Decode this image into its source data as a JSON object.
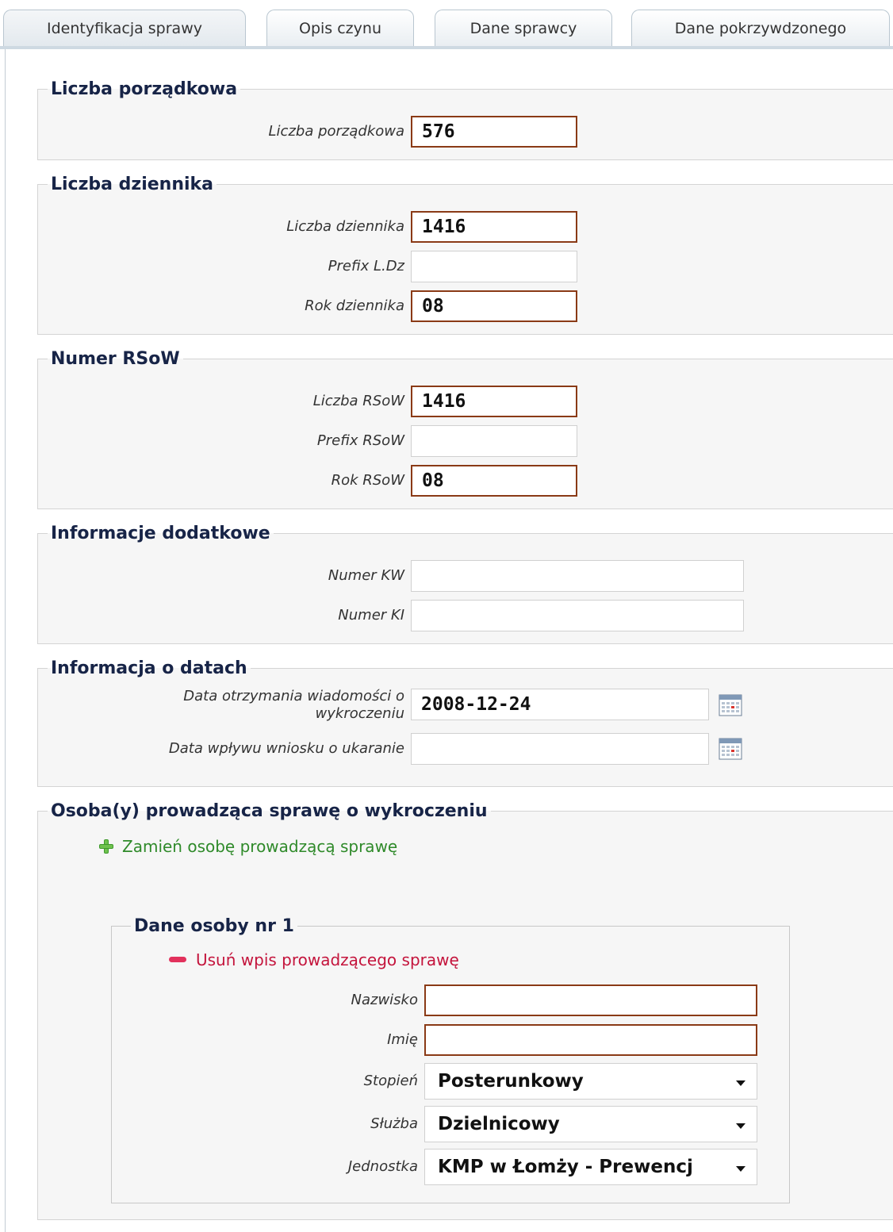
{
  "tabs": [
    {
      "label": "Identyfikacja sprawy",
      "active": true
    },
    {
      "label": "Opis czynu",
      "active": false
    },
    {
      "label": "Dane sprawcy",
      "active": false
    },
    {
      "label": "Dane pokrzywdzonego",
      "active": false
    }
  ],
  "liczba_porzadkowa": {
    "legend": "Liczba porządkowa",
    "field_label": "Liczba porządkowa",
    "value": "576"
  },
  "liczba_dziennika": {
    "legend": "Liczba dziennika",
    "liczba_label": "Liczba dziennika",
    "liczba_value": "1416",
    "prefix_label": "Prefix L.Dz",
    "prefix_value": "",
    "rok_label": "Rok dziennika",
    "rok_value": "08"
  },
  "numer_rsow": {
    "legend": "Numer RSoW",
    "liczba_label": "Liczba RSoW",
    "liczba_value": "1416",
    "prefix_label": "Prefix RSoW",
    "prefix_value": "",
    "rok_label": "Rok RSoW",
    "rok_value": "08"
  },
  "informacje_dodatkowe": {
    "legend": "Informacje dodatkowe",
    "kw_label": "Numer KW",
    "kw_value": "",
    "ki_label": "Numer KI",
    "ki_value": ""
  },
  "informacja_o_datach": {
    "legend": "Informacja o datach",
    "data_otrzymania_label_line1": "Data otrzymania wiadomości o",
    "data_otrzymania_label_line2": "wykroczeniu",
    "data_otrzymania_value": "2008-12-24",
    "data_wplywu_label": "Data wpływu wniosku o ukaranie",
    "data_wplywu_value": ""
  },
  "osoby_prowadzace": {
    "legend": "Osoba(y) prowadząca sprawę o wykroczeniu",
    "zamien_link": "Zamień osobę prowadzącą sprawę",
    "osoba": {
      "legend": "Dane osoby nr 1",
      "usun_link": "Usuń wpis prowadzącego sprawę",
      "nazwisko_label": "Nazwisko",
      "nazwisko_value": "",
      "imie_label": "Imię",
      "imie_value": "",
      "stopien_label": "Stopień",
      "stopien_value": "Posterunkowy",
      "sluzba_label": "Służba",
      "sluzba_value": "Dzielnicowy",
      "jednostka_label": "Jednostka",
      "jednostka_value": "KMP w Łomży - Prewencj"
    }
  },
  "icons": {
    "calendar": "calendar-icon",
    "add": "plus-icon",
    "remove": "minus-icon",
    "dropdown": "chevron-down-icon"
  },
  "colors": {
    "required_border": "#8a3a16",
    "legend_text": "#172447",
    "add_link": "#2f8a2a",
    "remove_link": "#c4143c",
    "fieldset_bg": "#f6f6f6"
  }
}
